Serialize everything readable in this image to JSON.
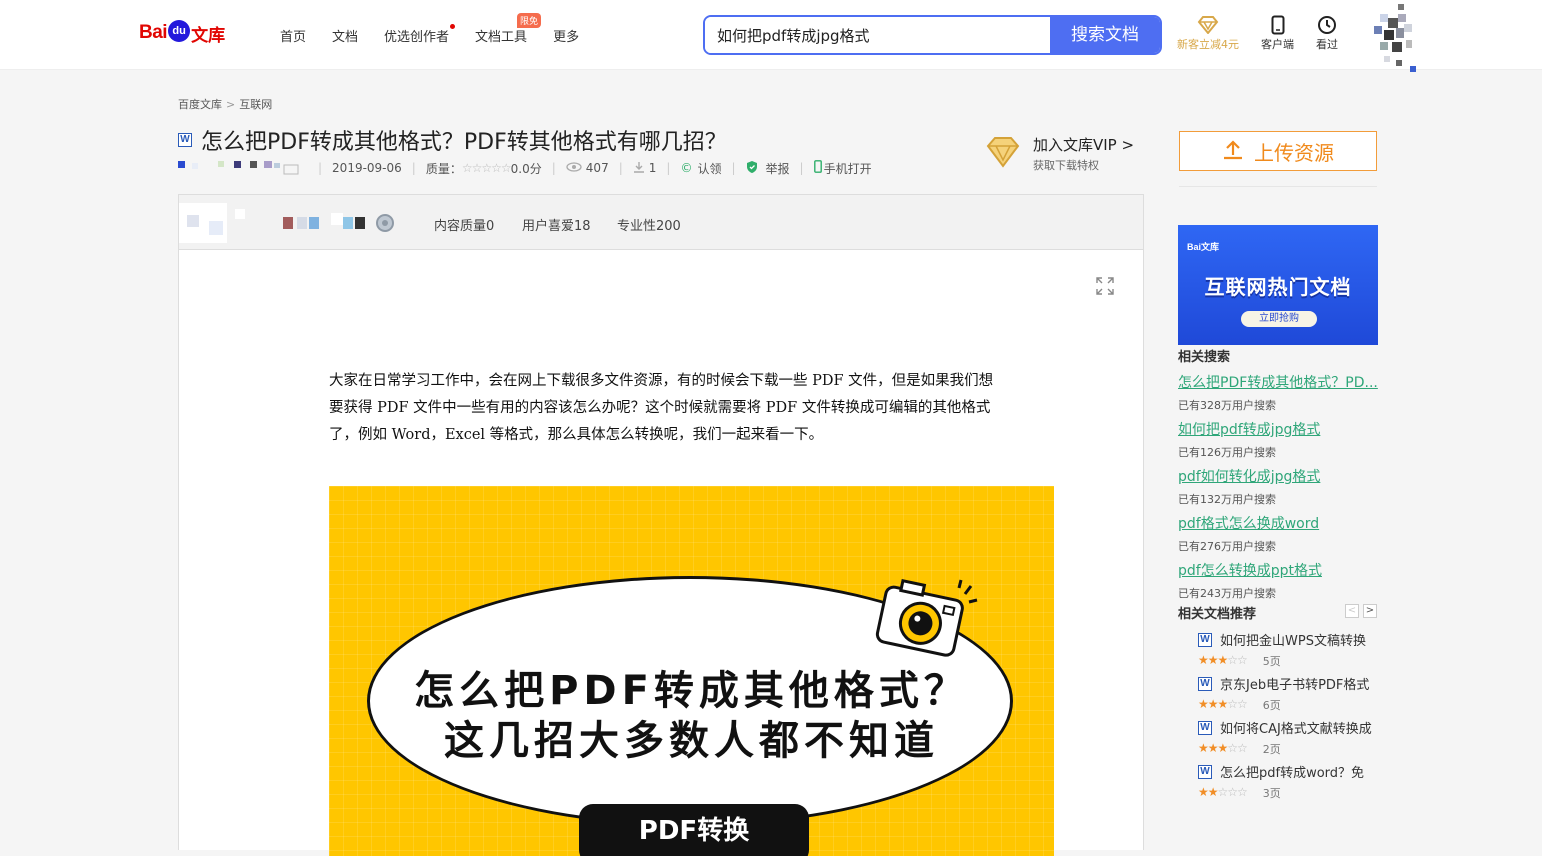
{
  "header": {
    "logo": {
      "bai": "Bai",
      "du": "du",
      "wenku": "文库"
    },
    "nav": [
      {
        "label": "首页"
      },
      {
        "label": "文档"
      },
      {
        "label": "优选创作者"
      },
      {
        "label": "文档工具",
        "badge": "限免"
      },
      {
        "label": "更多"
      }
    ],
    "search": {
      "value": "如何把pdf转成jpg格式",
      "button": "搜索文档"
    },
    "tools": [
      {
        "label": "新客立减4元",
        "icon": "diamond-icon"
      },
      {
        "label": "客户端",
        "icon": "phone-icon"
      },
      {
        "label": "看过",
        "icon": "clock-icon"
      }
    ]
  },
  "breadcrumb": {
    "root": "百度文库",
    "sep": ">",
    "current": "互联网"
  },
  "document": {
    "type_icon": "W",
    "title": "怎么把PDF转成其他格式？PDF转其他格式有哪几招？",
    "date": "2019-09-06",
    "quality_label": "质量：",
    "stars": "☆☆☆☆☆",
    "score": "0.0分",
    "views": "407",
    "downloads": "1",
    "claim": "认领",
    "report": "举报",
    "mobile": "手机打开",
    "stats": [
      "内容质量0",
      "用户喜爱18",
      "专业性200"
    ],
    "paragraph": "大家在日常学习工作中，会在网上下载很多文件资源，有的时候会下载一些 PDF 文件，但是如果我们想要获得 PDF 文件中一些有用的内容该怎么办呢？这个时候就需要将 PDF 文件转换成可编辑的其他格式了，例如 Word，Excel 等格式，那么具体怎么转换呢，我们一起来看一下。",
    "cover": {
      "line1": "怎么把PDF转成其他格式？",
      "line2": "这几招大多数人都不知道",
      "ribbon": "PDF转换"
    }
  },
  "vip": {
    "title": "加入文库VIP >",
    "subtitle": "获取下载特权"
  },
  "sidebar": {
    "upload": "上传资源",
    "banner": {
      "logo": "Bai文库",
      "title": "互联网热门文档",
      "button": "立即抢购"
    },
    "related_search_title": "相关搜索",
    "related_search": [
      {
        "text": "怎么把PDF转成其他格式？PD...",
        "count": "已有328万用户搜索"
      },
      {
        "text": "如何把pdf转成jpg格式",
        "count": "已有126万用户搜索"
      },
      {
        "text": "pdf如何转化成jpg格式",
        "count": "已有132万用户搜索"
      },
      {
        "text": "pdf格式怎么换成word",
        "count": "已有276万用户搜索"
      },
      {
        "text": "pdf怎么转换成ppt格式",
        "count": "已有243万用户搜索"
      }
    ],
    "recommend_title": "相关文档推荐",
    "pager": {
      "prev": "<",
      "next": ">"
    },
    "recommend": [
      {
        "name": "如何把金山WPS文稿转换",
        "stars_on": "★★",
        "stars_half": "★",
        "stars_off": "☆☆",
        "pages": "5页"
      },
      {
        "name": "京东Jeb电子书转PDF格式",
        "stars_on": "★★★",
        "stars_half": "",
        "stars_off": "☆☆",
        "pages": "6页"
      },
      {
        "name": "如何将CAJ格式文献转换成",
        "stars_on": "★★",
        "stars_half": "★",
        "stars_off": "☆☆",
        "pages": "2页"
      },
      {
        "name": "怎么把pdf转成word？免",
        "stars_on": "★★",
        "stars_half": "",
        "stars_off": "☆☆☆",
        "pages": "3页"
      }
    ]
  },
  "colors": {
    "brand_red": "#e10602",
    "brand_blue": "#4e6ef2",
    "link_green": "#2fa679",
    "upload_orange": "#f08a1c",
    "cover_yellow": "#ffc600"
  }
}
